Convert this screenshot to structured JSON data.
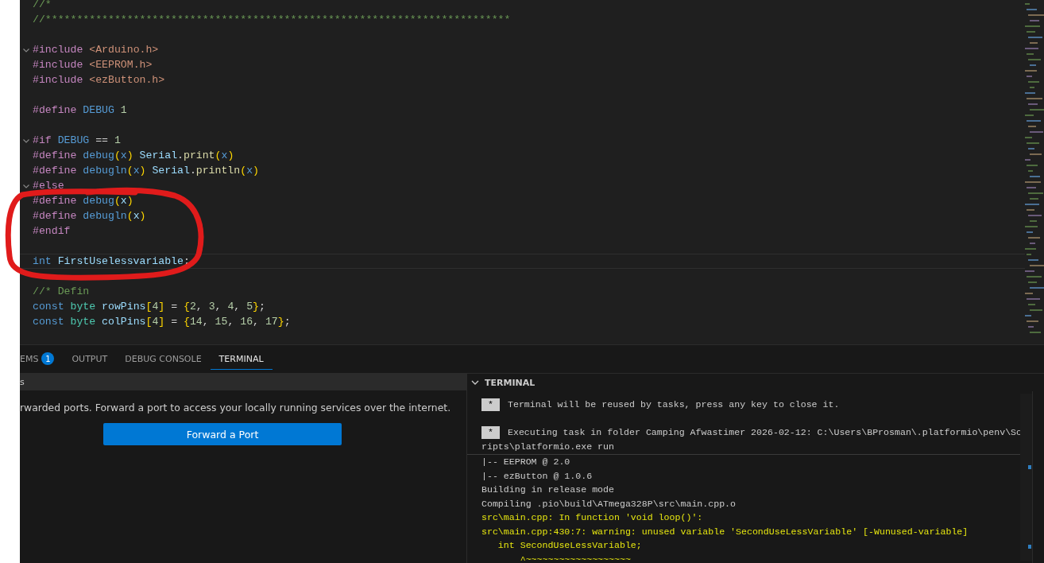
{
  "editor": {
    "lines": [
      {
        "kind": "code",
        "foldable": false,
        "current": false,
        "tokens": [
          {
            "text": "//*",
            "kind": "comment"
          }
        ]
      },
      {
        "kind": "code",
        "foldable": false,
        "current": false,
        "tokens": [
          {
            "text": "//**************************************************************************",
            "kind": "comment"
          }
        ]
      },
      {
        "kind": "blank"
      },
      {
        "kind": "code",
        "foldable": true,
        "current": false,
        "tokens": [
          {
            "text": "#include ",
            "kind": "macro"
          },
          {
            "text": "<Arduino.h>",
            "kind": "string"
          }
        ]
      },
      {
        "kind": "code",
        "foldable": false,
        "current": false,
        "tokens": [
          {
            "text": "#include ",
            "kind": "macro"
          },
          {
            "text": "<EEPROM.h>",
            "kind": "string"
          }
        ]
      },
      {
        "kind": "code",
        "foldable": false,
        "current": false,
        "tokens": [
          {
            "text": "#include ",
            "kind": "macro"
          },
          {
            "text": "<ezButton.h>",
            "kind": "string"
          }
        ]
      },
      {
        "kind": "blank"
      },
      {
        "kind": "code",
        "foldable": false,
        "current": false,
        "tokens": [
          {
            "text": "#define ",
            "kind": "macro"
          },
          {
            "text": "DEBUG ",
            "kind": "name"
          },
          {
            "text": "1",
            "kind": "number"
          }
        ]
      },
      {
        "kind": "blank"
      },
      {
        "kind": "code",
        "foldable": true,
        "current": false,
        "tokens": [
          {
            "text": "#if ",
            "kind": "macro"
          },
          {
            "text": "DEBUG",
            "kind": "name"
          },
          {
            "text": " == ",
            "kind": "plain"
          },
          {
            "text": "1",
            "kind": "number"
          }
        ]
      },
      {
        "kind": "code",
        "foldable": false,
        "current": false,
        "tokens": [
          {
            "text": "#define ",
            "kind": "macro"
          },
          {
            "text": "debug",
            "kind": "name"
          },
          {
            "text": "(",
            "kind": "bracket"
          },
          {
            "text": "x",
            "kind": "name"
          },
          {
            "text": ") ",
            "kind": "bracket"
          },
          {
            "text": "Serial",
            "kind": "variable"
          },
          {
            "text": ".",
            "kind": "plain"
          },
          {
            "text": "print",
            "kind": "function"
          },
          {
            "text": "(",
            "kind": "bracket"
          },
          {
            "text": "x",
            "kind": "name"
          },
          {
            "text": ")",
            "kind": "bracket"
          }
        ]
      },
      {
        "kind": "code",
        "foldable": false,
        "current": false,
        "tokens": [
          {
            "text": "#define ",
            "kind": "macro"
          },
          {
            "text": "debugln",
            "kind": "name"
          },
          {
            "text": "(",
            "kind": "bracket"
          },
          {
            "text": "x",
            "kind": "name"
          },
          {
            "text": ") ",
            "kind": "bracket"
          },
          {
            "text": "Serial",
            "kind": "variable"
          },
          {
            "text": ".",
            "kind": "plain"
          },
          {
            "text": "println",
            "kind": "function"
          },
          {
            "text": "(",
            "kind": "bracket"
          },
          {
            "text": "x",
            "kind": "name"
          },
          {
            "text": ")",
            "kind": "bracket"
          }
        ]
      },
      {
        "kind": "code",
        "foldable": true,
        "current": false,
        "tokens": [
          {
            "text": "#else",
            "kind": "macro"
          }
        ]
      },
      {
        "kind": "code",
        "foldable": false,
        "current": false,
        "tokens": [
          {
            "text": "#define ",
            "kind": "macro"
          },
          {
            "text": "debug",
            "kind": "name"
          },
          {
            "text": "(",
            "kind": "bracket"
          },
          {
            "text": "x",
            "kind": "variable"
          },
          {
            "text": ")",
            "kind": "bracket"
          }
        ]
      },
      {
        "kind": "code",
        "foldable": false,
        "current": false,
        "tokens": [
          {
            "text": "#define ",
            "kind": "macro"
          },
          {
            "text": "debugln",
            "kind": "name"
          },
          {
            "text": "(",
            "kind": "bracket"
          },
          {
            "text": "x",
            "kind": "variable"
          },
          {
            "text": ")",
            "kind": "bracket"
          }
        ]
      },
      {
        "kind": "code",
        "foldable": false,
        "current": false,
        "tokens": [
          {
            "text": "#endif",
            "kind": "macro"
          }
        ]
      },
      {
        "kind": "blank"
      },
      {
        "kind": "code",
        "foldable": false,
        "current": true,
        "tokens": [
          {
            "text": "int ",
            "kind": "keyword"
          },
          {
            "text": "FirstUselessvariable",
            "kind": "variable"
          },
          {
            "text": ";",
            "kind": "plain"
          }
        ]
      },
      {
        "kind": "blank"
      },
      {
        "kind": "code",
        "foldable": false,
        "current": false,
        "tokens": [
          {
            "text": "//* Defin",
            "kind": "comment"
          }
        ]
      },
      {
        "kind": "code",
        "foldable": false,
        "current": false,
        "tokens": [
          {
            "text": "const ",
            "kind": "keyword"
          },
          {
            "text": "byte ",
            "kind": "type"
          },
          {
            "text": "rowPins",
            "kind": "variable"
          },
          {
            "text": "[",
            "kind": "bracket"
          },
          {
            "text": "4",
            "kind": "number"
          },
          {
            "text": "]",
            "kind": "bracket"
          },
          {
            "text": " = ",
            "kind": "plain"
          },
          {
            "text": "{",
            "kind": "bracket"
          },
          {
            "text": "2",
            "kind": "number"
          },
          {
            "text": ", ",
            "kind": "plain"
          },
          {
            "text": "3",
            "kind": "number"
          },
          {
            "text": ", ",
            "kind": "plain"
          },
          {
            "text": "4",
            "kind": "number"
          },
          {
            "text": ", ",
            "kind": "plain"
          },
          {
            "text": "5",
            "kind": "number"
          },
          {
            "text": "}",
            "kind": "bracket"
          },
          {
            "text": ";",
            "kind": "plain"
          }
        ]
      },
      {
        "kind": "code",
        "foldable": false,
        "current": false,
        "tokens": [
          {
            "text": "const ",
            "kind": "keyword"
          },
          {
            "text": "byte ",
            "kind": "type"
          },
          {
            "text": "colPins",
            "kind": "variable"
          },
          {
            "text": "[",
            "kind": "bracket"
          },
          {
            "text": "4",
            "kind": "number"
          },
          {
            "text": "]",
            "kind": "bracket"
          },
          {
            "text": " = ",
            "kind": "plain"
          },
          {
            "text": "{",
            "kind": "bracket"
          },
          {
            "text": "14",
            "kind": "number"
          },
          {
            "text": ", ",
            "kind": "plain"
          },
          {
            "text": "15",
            "kind": "number"
          },
          {
            "text": ", ",
            "kind": "plain"
          },
          {
            "text": "16",
            "kind": "number"
          },
          {
            "text": ", ",
            "kind": "plain"
          },
          {
            "text": "17",
            "kind": "number"
          },
          {
            "text": "}",
            "kind": "bracket"
          },
          {
            "text": ";",
            "kind": "plain"
          }
        ]
      }
    ]
  },
  "panel": {
    "tabs": [
      {
        "label": "EMS",
        "badge": "1",
        "selected": false
      },
      {
        "label": "OUTPUT",
        "selected": false
      },
      {
        "label": "DEBUG CONSOLE",
        "selected": false
      },
      {
        "label": "TERMINAL",
        "selected": true
      }
    ],
    "ports": {
      "header": "s",
      "message": "rwarded ports. Forward a port to access your locally running services over the internet.",
      "button": "Forward a Port"
    },
    "terminal": {
      "header": "TERMINAL",
      "sticky": [
        {
          "kind": "task",
          "badge": "*",
          "text": "Terminal will be reused by tasks, press any key to close it."
        },
        {
          "kind": "blank"
        },
        {
          "kind": "task",
          "badge": "*",
          "text": "Executing task in folder Camping Afwastimer 2026-02-12: C:\\Users\\BProsman\\.platformio\\penv\\Sc"
        },
        {
          "kind": "plain",
          "text": "ripts\\platformio.exe run"
        }
      ],
      "lines": [
        {
          "kind": "plain",
          "text": "|-- EEPROM @ 2.0"
        },
        {
          "kind": "plain",
          "text": "|-- ezButton @ 1.0.6"
        },
        {
          "kind": "plain",
          "text": "Building in release mode"
        },
        {
          "kind": "plain",
          "text": "Compiling .pio\\build\\ATmega328P\\src\\main.cpp.o"
        },
        {
          "kind": "warning",
          "text": "src\\main.cpp: In function 'void loop()':"
        },
        {
          "kind": "warning",
          "text": "src\\main.cpp:430:7: warning: unused variable 'SecondUseLessVariable' [-Wunused-variable]"
        },
        {
          "kind": "warning",
          "text": "   int SecondUseLessVariable;"
        },
        {
          "kind": "warning",
          "text": "       ^~~~~~~~~~~~~~~~~~~~"
        }
      ]
    }
  }
}
